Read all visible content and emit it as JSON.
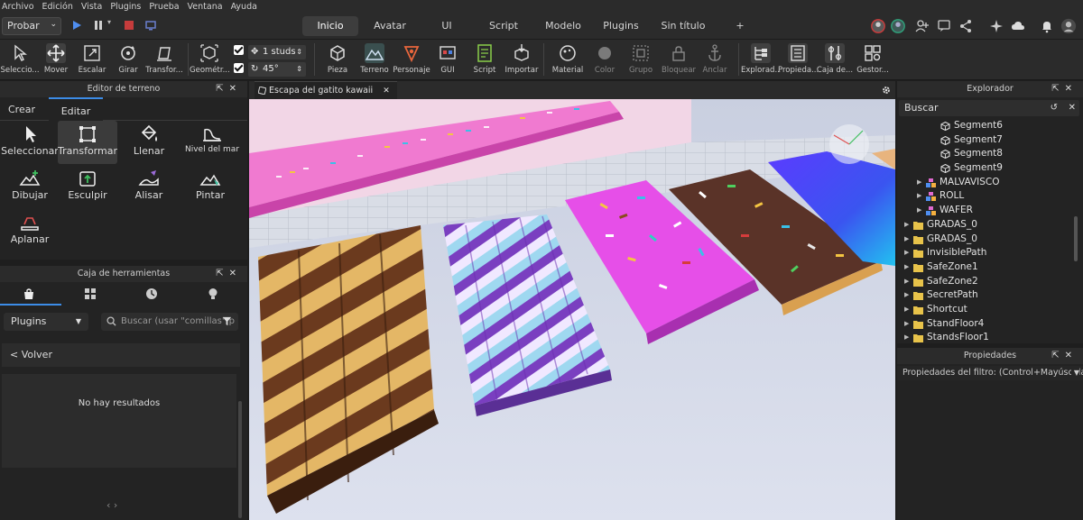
{
  "menu": [
    "Archivo",
    "Edición",
    "Vista",
    "Plugins",
    "Prueba",
    "Ventana",
    "Ayuda"
  ],
  "topbar": {
    "mode_selector": "Probar",
    "tabs": [
      {
        "label": "Inicio",
        "active": true
      },
      {
        "label": "Avatar",
        "active": false
      },
      {
        "label": "UI",
        "active": false
      },
      {
        "label": "Script",
        "active": false
      },
      {
        "label": "Modelo",
        "active": false
      },
      {
        "label": "Plugins",
        "active": false
      },
      {
        "label": "Sin título",
        "active": false
      },
      {
        "label": "+",
        "active": false
      }
    ]
  },
  "ribbon": {
    "tools": [
      "Seleccio...",
      "Mover",
      "Escalar",
      "Girar",
      "Transfor...",
      "Geométr..."
    ],
    "move_increment": "1 studs",
    "rotate_increment": "45°",
    "insert": [
      "Pieza",
      "Terreno",
      "Personaje",
      "GUI",
      "Script",
      "Importar"
    ],
    "edit": [
      "Material",
      "Color",
      "Grupo",
      "Bloquear",
      "Anclar"
    ],
    "panels": [
      "Explorad...",
      "Propieda...",
      "Caja de...",
      "Gestor..."
    ]
  },
  "terrain_editor": {
    "title": "Editor de terreno",
    "tabs": [
      {
        "label": "Crear",
        "active": false
      },
      {
        "label": "Editar",
        "active": true
      }
    ],
    "tools": [
      "Seleccionar",
      "Transformar",
      "Llenar",
      "Nivel del mar",
      "Dibujar",
      "Esculpir",
      "Alisar",
      "Pintar",
      "Aplanar"
    ],
    "selected_tool": "Transformar"
  },
  "toolbox": {
    "title": "Caja de herramientas",
    "filter": "Plugins",
    "search_placeholder": "Buscar (usar \"comillas\" p",
    "back": "< Volver",
    "empty": "No hay resultados",
    "pager": "‹  ›"
  },
  "viewport": {
    "tab_title": "Escapa del gatito kawaii"
  },
  "explorer": {
    "title": "Explorador",
    "search_placeholder": "Buscar",
    "items": [
      {
        "label": "Segment6",
        "type": "part",
        "depth": 2,
        "expandable": false
      },
      {
        "label": "Segment7",
        "type": "part",
        "depth": 2,
        "expandable": false
      },
      {
        "label": "Segment8",
        "type": "part",
        "depth": 2,
        "expandable": false
      },
      {
        "label": "Segment9",
        "type": "part",
        "depth": 2,
        "expandable": false
      },
      {
        "label": "MALVAVISCO",
        "type": "model",
        "depth": 1,
        "expandable": true
      },
      {
        "label": "ROLL",
        "type": "model",
        "depth": 1,
        "expandable": true
      },
      {
        "label": "WAFER",
        "type": "model",
        "depth": 1,
        "expandable": true
      },
      {
        "label": "GRADAS_0",
        "type": "folder",
        "depth": 0,
        "expandable": true
      },
      {
        "label": "GRADAS_0",
        "type": "folder",
        "depth": 0,
        "expandable": true
      },
      {
        "label": "InvisiblePath",
        "type": "folder",
        "depth": 0,
        "expandable": true
      },
      {
        "label": "SafeZone1",
        "type": "folder",
        "depth": 0,
        "expandable": true
      },
      {
        "label": "SafeZone2",
        "type": "folder",
        "depth": 0,
        "expandable": true
      },
      {
        "label": "SecretPath",
        "type": "folder",
        "depth": 0,
        "expandable": true
      },
      {
        "label": "Shortcut",
        "type": "folder",
        "depth": 0,
        "expandable": true
      },
      {
        "label": "StandFloor4",
        "type": "folder",
        "depth": 0,
        "expandable": true
      },
      {
        "label": "StandsFloor1",
        "type": "folder",
        "depth": 0,
        "expandable": true
      }
    ]
  },
  "properties": {
    "title": "Propiedades",
    "filter_placeholder": "Propiedades del filtro: (Control+Mayúsculas..."
  },
  "colors": {
    "accent": "#3c8ce7",
    "panel": "#232323",
    "header": "#2b2b2b",
    "folder": "#e8c34a"
  }
}
